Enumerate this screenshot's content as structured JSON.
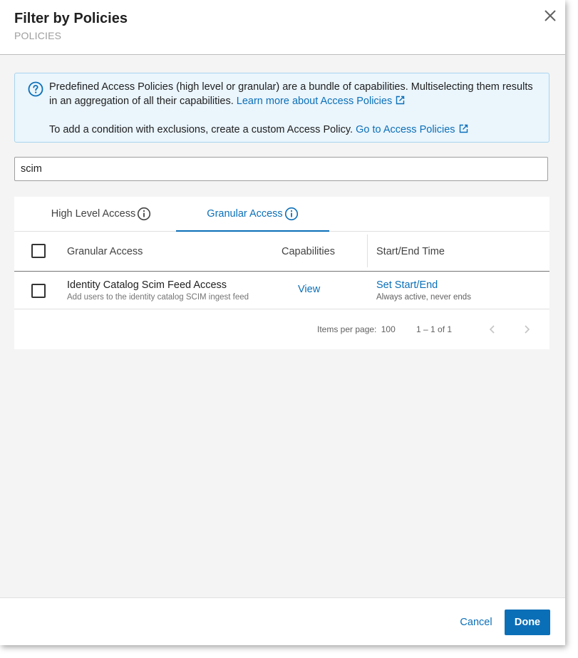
{
  "dialog": {
    "title": "Filter by Policies",
    "subtitle": "POLICIES",
    "close_icon": "close-icon"
  },
  "info": {
    "icon": "help-circle-icon",
    "text1": "Predefined Access Policies (high level or granular) are a bundle of capabilities. Multiselecting them results in an aggregation of all their capabilities.",
    "link1": "Learn more about Access Policies",
    "text2": "To add a condition with exclusions, create a custom Access Policy.",
    "link2": "Go to Access Policies"
  },
  "search": {
    "value": "scim"
  },
  "tabs": [
    {
      "label": "High Level Access",
      "active": false
    },
    {
      "label": "Granular Access",
      "active": true
    }
  ],
  "table": {
    "columns": [
      "Granular Access",
      "Capabilities",
      "Start/End Time"
    ],
    "rows": [
      {
        "name": "Identity Catalog Scim Feed Access",
        "description": "Add users to the identity catalog SCIM ingest feed",
        "capabilities": "View",
        "start_end": "Set Start/End",
        "start_end_note": "Always active, never ends"
      }
    ]
  },
  "pagination": {
    "items_per_page_label": "Items per page:",
    "items_per_page": "100",
    "range": "1 – 1 of 1"
  },
  "footer": {
    "cancel_label": "Cancel",
    "done_label": "Done"
  },
  "colors": {
    "accent": "#0b6fb8",
    "info_bg": "#eaf5fc",
    "info_border": "#a9d4ef"
  }
}
